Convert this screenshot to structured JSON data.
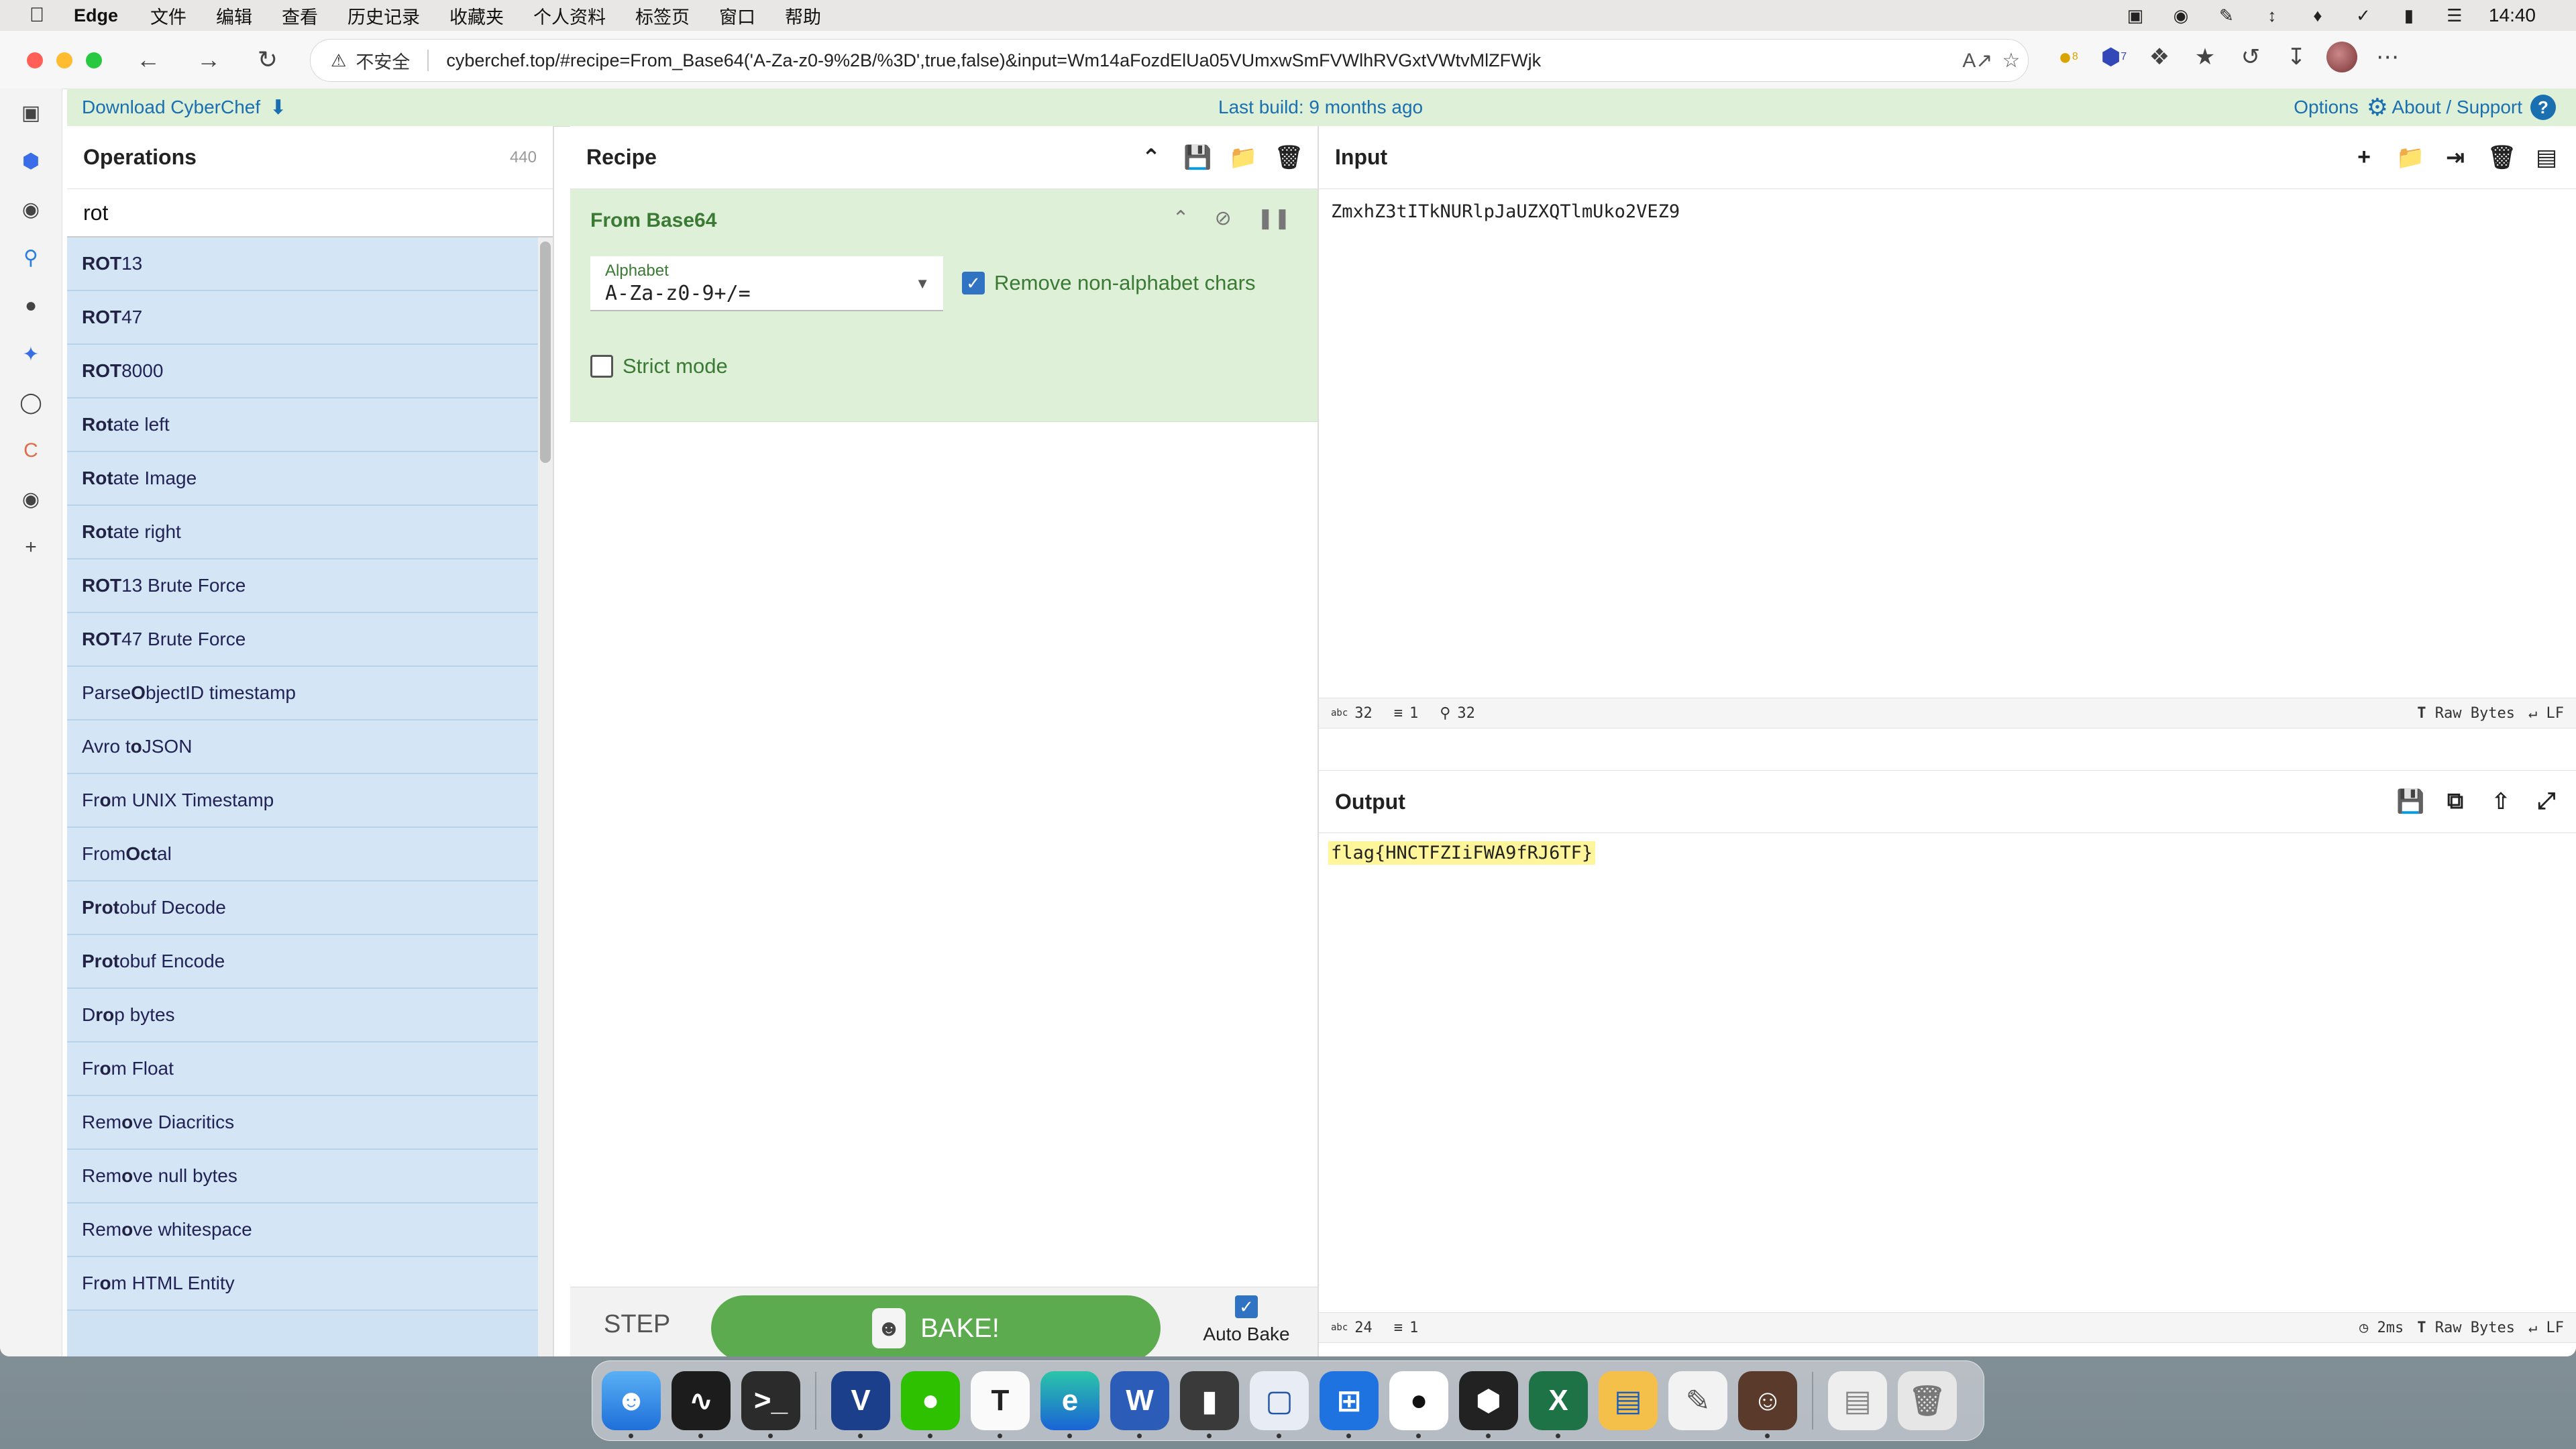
{
  "menubar": {
    "app": "Edge",
    "items": [
      "文件",
      "编辑",
      "查看",
      "历史记录",
      "收藏夹",
      "个人资料",
      "标签页",
      "窗口",
      "帮助"
    ],
    "clock": "14:40"
  },
  "browser": {
    "security_label": "不安全",
    "url": "cyberchef.top/#recipe=From_Base64('A-Za-z0-9%2B/%3D',true,false)&input=Wm14aFozdElUa05VUmxwSmFVWlhRVGxtVWtvMlZFWjk",
    "extension_badges": [
      "8",
      "7"
    ]
  },
  "banner": {
    "download": "Download CyberChef",
    "last_build": "Last build: 9 months ago",
    "options": "Options",
    "about": "About / Support"
  },
  "operations": {
    "title": "Operations",
    "count": "440",
    "search_value": "rot",
    "items": [
      {
        "pre": "",
        "hl": "ROT",
        "post": "13"
      },
      {
        "pre": "",
        "hl": "ROT",
        "post": "47"
      },
      {
        "pre": "",
        "hl": "ROT",
        "post": "8000"
      },
      {
        "pre": "",
        "hl": "Rot",
        "post": "ate left"
      },
      {
        "pre": "",
        "hl": "Rot",
        "post": "ate Image"
      },
      {
        "pre": "",
        "hl": "Rot",
        "post": "ate right"
      },
      {
        "pre": "",
        "hl": "ROT",
        "post": "13 Brute Force"
      },
      {
        "pre": "",
        "hl": "ROT",
        "post": "47 Brute Force"
      },
      {
        "pre": "Parse ",
        "hl": "O",
        "post": "bjectID timestamp"
      },
      {
        "pre": "Avro t",
        "hl": "o",
        "post": " JSON"
      },
      {
        "pre": "Fr",
        "hl": "o",
        "post": "m UNIX Timestamp"
      },
      {
        "pre": "From ",
        "hl": "Oct",
        "post": "al"
      },
      {
        "pre": "",
        "hl": "Prot",
        "post": "obuf Decode"
      },
      {
        "pre": "",
        "hl": "Prot",
        "post": "obuf Encode"
      },
      {
        "pre": "D",
        "hl": "ro",
        "post": "p bytes"
      },
      {
        "pre": "Fr",
        "hl": "o",
        "post": "m Float"
      },
      {
        "pre": "Rem",
        "hl": "o",
        "post": "ve Diacritics"
      },
      {
        "pre": "Rem",
        "hl": "o",
        "post": "ve null bytes"
      },
      {
        "pre": "Rem",
        "hl": "o",
        "post": "ve whitespace"
      },
      {
        "pre": "Fr",
        "hl": "o",
        "post": "m HTML Entity"
      }
    ]
  },
  "recipe": {
    "title": "Recipe",
    "operation": {
      "name": "From Base64",
      "alphabet_label": "Alphabet",
      "alphabet_value": "A-Za-z0-9+/=",
      "remove_non_alpha_label": "Remove non-alphabet chars",
      "remove_non_alpha_checked": true,
      "strict_mode_label": "Strict mode",
      "strict_mode_checked": false
    },
    "step_label": "STEP",
    "bake_label": "BAKE!",
    "auto_bake_label": "Auto Bake",
    "auto_bake_checked": true
  },
  "input": {
    "title": "Input",
    "value": "ZmxhZ3tITkNURlpJaUZXQTlmUko2VEZ9",
    "status": {
      "length": "32",
      "lines": "1",
      "position": "32",
      "encoding": "Raw Bytes",
      "eol": "LF"
    }
  },
  "output": {
    "title": "Output",
    "value": "flag{HNCTFZIiFWA9fRJ6TF}",
    "status": {
      "length": "24",
      "lines": "1",
      "time": "2ms",
      "encoding": "Raw Bytes",
      "eol": "LF"
    }
  },
  "colors": {
    "accent_green": "#5cab4f",
    "op_highlight": "#dff0d8",
    "link_blue": "#1a6fb0",
    "op_list_bg": "#d4e5f5"
  }
}
